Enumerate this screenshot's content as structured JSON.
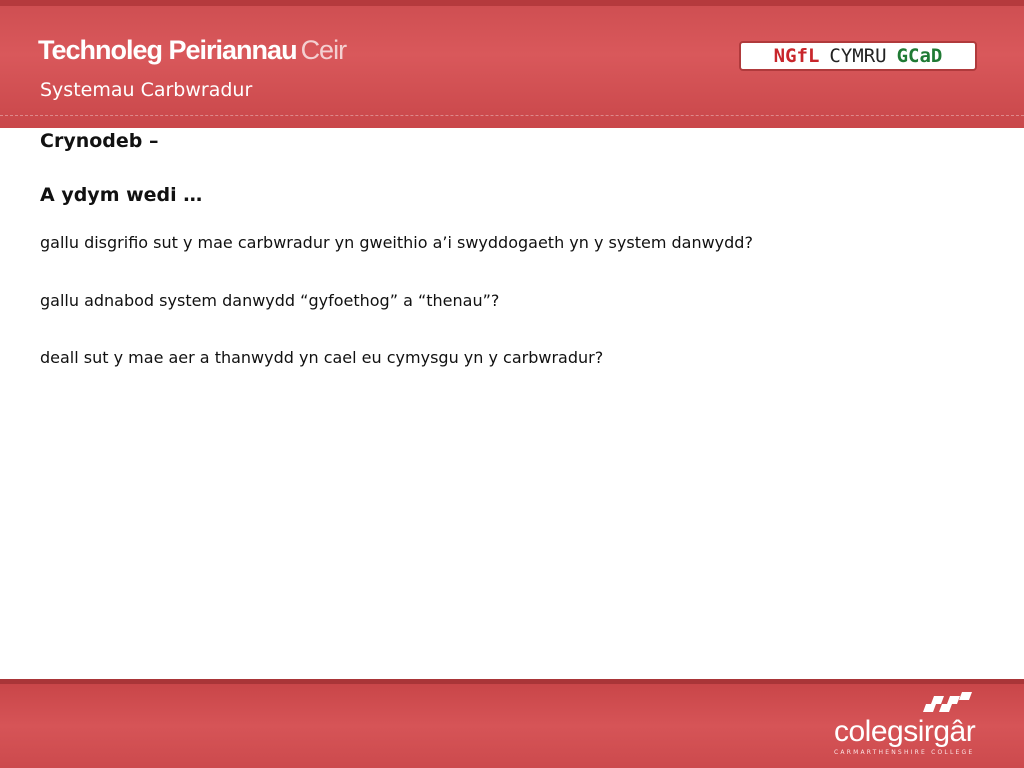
{
  "header": {
    "title_bold": "Technoleg Peiriannau",
    "title_light": "Ceir",
    "subtitle": "Systemau Carbwradur",
    "logo": {
      "ngfl": "NGfL",
      "cymru": "CYMRU",
      "gcad": "GCaD"
    }
  },
  "content": {
    "heading1": "Crynodeb –",
    "heading2": "A ydym wedi …",
    "items": [
      "gallu disgrifio sut y mae carbwradur yn gweithio a’i swyddogaeth yn y system danwydd?",
      "gallu adnabod system danwydd “gyfoethog” a “thenau”?",
      "deall sut y mae aer a thanwydd yn cael eu cymysgu yn y carbwradur?"
    ]
  },
  "footer": {
    "brand_name": "colegsirgâr",
    "brand_sub": "CARMARTHENSHIRE COLLEGE"
  },
  "colors": {
    "banner": "#d4585b",
    "banner_dark": "#b53a3d",
    "text": "#111111"
  }
}
